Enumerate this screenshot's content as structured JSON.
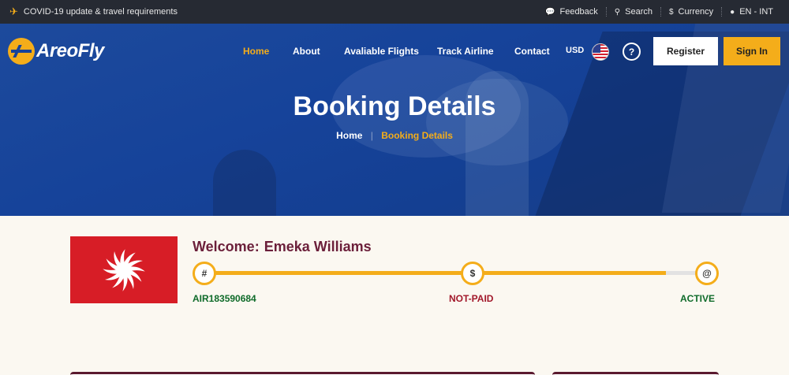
{
  "topbar": {
    "notice": "COVID-19 update & travel requirements",
    "links": [
      {
        "icon": "comments-icon",
        "label": "Feedback"
      },
      {
        "icon": "search-icon",
        "label": "Search"
      },
      {
        "icon": "dollar-icon",
        "label": "Currency"
      },
      {
        "icon": "globe-icon",
        "label": "EN - INT"
      }
    ]
  },
  "brand": {
    "name": "AreoFly"
  },
  "nav": {
    "items": [
      "Home",
      "About",
      "Avaliable Flights",
      "Track Airline",
      "Contact"
    ],
    "active": "Home",
    "currency": "USD",
    "help": "?",
    "register": "Register",
    "signin": "Sign In"
  },
  "hero": {
    "title": "Booking Details",
    "breadcrumb": {
      "home": "Home",
      "separator": "|",
      "current": "Booking Details"
    }
  },
  "booking": {
    "welcome_label": "Welcome:",
    "name": "Emeka Williams",
    "steps": [
      {
        "symbol": "#",
        "label": "AIR183590684",
        "color": "#0f6b2a"
      },
      {
        "symbol": "$",
        "label": "NOT-PAID",
        "color": "#a2192b"
      },
      {
        "symbol": "@",
        "label": "ACTIVE",
        "color": "#0f6b2a"
      }
    ],
    "progress_fraction": 0.94
  },
  "colors": {
    "accent": "#f4ad1a",
    "hero_blue": "#16439a",
    "topbar": "#262a33",
    "airline_red": "#d71d26",
    "welcome_text": "#6b1f3a"
  }
}
